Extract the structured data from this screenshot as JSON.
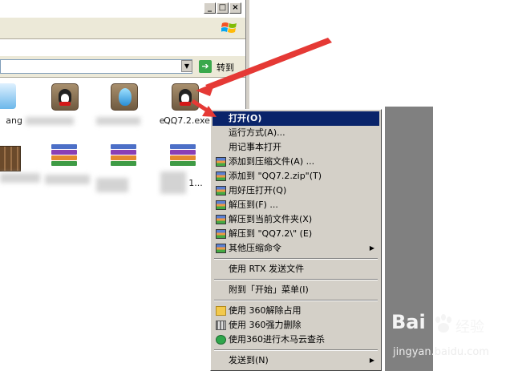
{
  "window": {
    "titlebar_buttons": [
      "_",
      "□",
      "×"
    ]
  },
  "addressbar": {
    "go_label": "转到",
    "go_icon": "green-arrow-icon"
  },
  "files": [
    {
      "label": "ang",
      "icon": "app-icon"
    },
    {
      "label": "",
      "icon": "qq-icon"
    },
    {
      "label": "e...",
      "icon": "blue-drop-icon"
    },
    {
      "label": "QQ7.2.exe",
      "icon": "qq-icon"
    },
    {
      "label": "",
      "icon": "archive-icon"
    },
    {
      "label": "",
      "icon": "winrar-icon"
    },
    {
      "label": "",
      "icon": "winrar-icon"
    },
    {
      "label": "1...",
      "icon": "winrar-icon"
    }
  ],
  "context_menu": {
    "items": [
      {
        "label": "打开(O)",
        "selected": true,
        "icon": ""
      },
      {
        "label": "运行方式(A)...",
        "icon": ""
      },
      {
        "label": "用记事本打开",
        "icon": ""
      },
      {
        "label": "添加到压缩文件(A) ...",
        "icon": "winrar-icon"
      },
      {
        "label": "添加到 \"QQ7.2.zip\"(T)",
        "icon": "winrar-icon"
      },
      {
        "label": "用好压打开(Q)",
        "icon": "winrar-icon"
      },
      {
        "label": "解压到(F) ...",
        "icon": "winrar-icon"
      },
      {
        "label": "解压到当前文件夹(X)",
        "icon": "winrar-icon"
      },
      {
        "label": "解压到 \"QQ7.2\\\" (E)",
        "icon": "winrar-icon"
      },
      {
        "label": "其他压缩命令",
        "icon": "winrar-icon",
        "submenu": true
      },
      {
        "label": "使用 RTX 发送文件",
        "icon": ""
      },
      {
        "label": "附到「开始」菜单(I)",
        "icon": ""
      },
      {
        "label": "使用 360解除占用",
        "icon": "unlock-icon"
      },
      {
        "label": "使用 360强力删除",
        "icon": "shredder-icon"
      },
      {
        "label": "使用360进行木马云查杀",
        "icon": "360-shield-icon"
      },
      {
        "label": "发送到(N)",
        "icon": "",
        "submenu": true
      }
    ]
  },
  "watermark": {
    "logo": "Bai",
    "logo_suffix": "经验",
    "site": "jingyan.baidu.com"
  },
  "colors": {
    "menu_bg": "#d4d0c8",
    "menu_selected": "#0a246a",
    "annotation_arrow": "#e53935"
  }
}
